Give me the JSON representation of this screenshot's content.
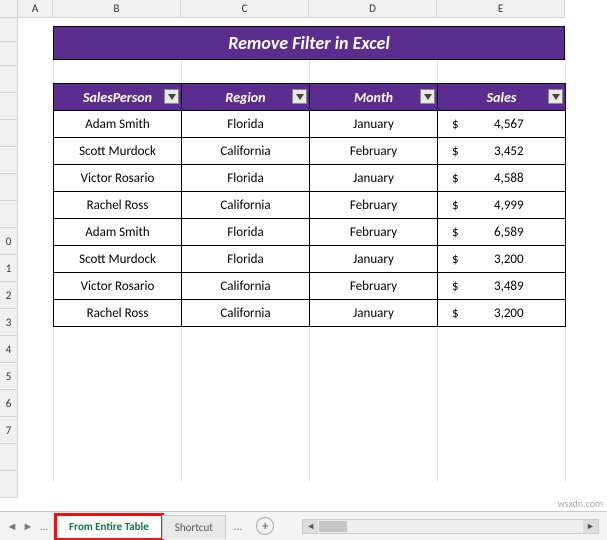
{
  "columns": [
    "A",
    "B",
    "C",
    "D",
    "E"
  ],
  "rows": [
    "",
    "",
    "",
    "",
    "",
    "",
    "",
    "",
    "0",
    "1",
    "2",
    "3",
    "4",
    "5",
    "6",
    "7",
    ""
  ],
  "title": "Remove Filter in Excel",
  "table": {
    "headers": [
      "SalesPerson",
      "Region",
      "Month",
      "Sales"
    ],
    "rows": [
      {
        "p": "Adam Smith",
        "r": "Florida",
        "m": "January",
        "s": "4,567"
      },
      {
        "p": "Scott Murdock",
        "r": "California",
        "m": "February",
        "s": "3,452"
      },
      {
        "p": "Victor Rosario",
        "r": "Florida",
        "m": "January",
        "s": "4,588"
      },
      {
        "p": "Rachel Ross",
        "r": "California",
        "m": "February",
        "s": "4,999"
      },
      {
        "p": "Adam Smith",
        "r": "Florida",
        "m": "February",
        "s": "6,589"
      },
      {
        "p": "Scott Murdock",
        "r": "Florida",
        "m": "January",
        "s": "3,200"
      },
      {
        "p": "Victor Rosario",
        "r": "California",
        "m": "February",
        "s": "3,489"
      },
      {
        "p": "Rachel Ross",
        "r": "California",
        "m": "January",
        "s": "3,200"
      }
    ],
    "currency": "$"
  },
  "tabs": {
    "active": "From Entire Table",
    "inactive": "Shortcut",
    "ellipsis": "..."
  },
  "nav": {
    "first": "|◄",
    "prev": "◄",
    "next": "►",
    "more": "...",
    "plus": "+"
  },
  "watermark": "wsxdn.com",
  "chart_data": {
    "type": "table",
    "title": "Remove Filter in Excel",
    "columns": [
      "SalesPerson",
      "Region",
      "Month",
      "Sales"
    ],
    "rows": [
      [
        "Adam Smith",
        "Florida",
        "January",
        4567
      ],
      [
        "Scott Murdock",
        "California",
        "February",
        3452
      ],
      [
        "Victor Rosario",
        "Florida",
        "January",
        4588
      ],
      [
        "Rachel Ross",
        "California",
        "February",
        4999
      ],
      [
        "Adam Smith",
        "Florida",
        "February",
        6589
      ],
      [
        "Scott Murdock",
        "Florida",
        "January",
        3200
      ],
      [
        "Victor Rosario",
        "California",
        "February",
        3489
      ],
      [
        "Rachel Ross",
        "California",
        "January",
        3200
      ]
    ]
  }
}
